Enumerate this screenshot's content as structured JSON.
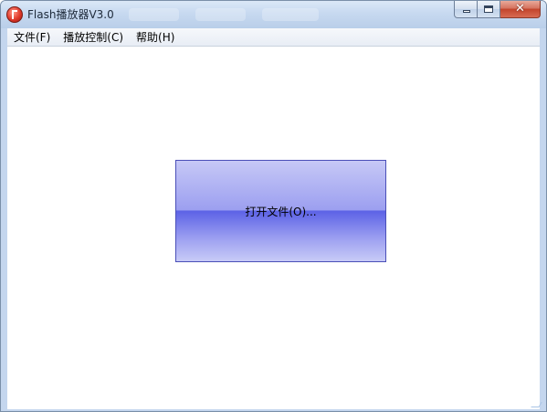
{
  "window": {
    "title": "Flash播放器V3.0",
    "icon": "flash-player-icon",
    "controls": {
      "minimize": "minimize-icon",
      "maximize": "maximize-icon",
      "close_glyph": "✕"
    }
  },
  "menubar": {
    "items": [
      {
        "label": "文件(F)"
      },
      {
        "label": "播放控制(C)"
      },
      {
        "label": "帮助(H)"
      }
    ]
  },
  "main": {
    "open_button_label": "打开文件(O)...",
    "open_button_colors": {
      "top": "#c6c8f6",
      "middle": "#5c62e6",
      "bottom": "#c8cbf7",
      "border": "#4a4fb8"
    }
  }
}
